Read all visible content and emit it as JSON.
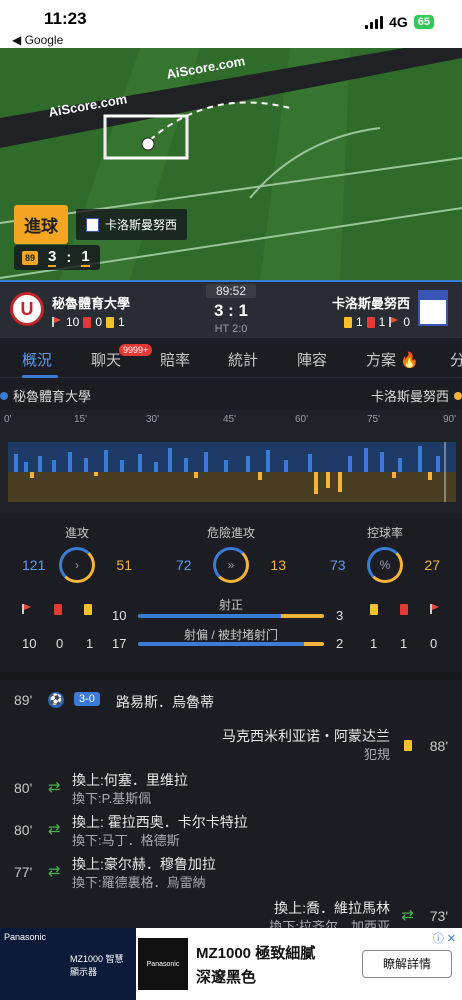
{
  "status": {
    "time": "11:23",
    "back_label": "◀ Google",
    "network": "4G",
    "battery": "65"
  },
  "pitch": {
    "brand": "AiScore.com",
    "goal_label": "進球",
    "goal_team": "卡洛斯曼努西",
    "mini_minute": "89",
    "mini_home": "3",
    "mini_sep": ":",
    "mini_away": "1"
  },
  "match": {
    "home_name": "秘魯體育大學",
    "away_name": "卡洛斯曼努西",
    "home_crest": "U",
    "time": "89:52",
    "score": "3 : 1",
    "ht": "HT 2:0",
    "home_corners": "10",
    "home_red": "0",
    "home_yellow": "1",
    "away_yellow": "1",
    "away_red": "1",
    "away_corners": "0"
  },
  "tabs": {
    "overview": "概況",
    "chat": "聊天",
    "chat_badge": "9999+",
    "odds": "賠率",
    "stats": "統計",
    "lineup": "陣容",
    "plan": "方案",
    "more": "分"
  },
  "teams_row": {
    "home": "秘魯體育大學",
    "away": "卡洛斯曼努西"
  },
  "timeline": {
    "ticks": [
      "0'",
      "15'",
      "30'",
      "45'",
      "60'",
      "75'",
      "90'"
    ]
  },
  "kpis": {
    "attack": {
      "title": "進攻",
      "home": "121",
      "away": "51",
      "icon": "chevron-right-icon"
    },
    "danger": {
      "title": "危險進攻",
      "home": "72",
      "away": "13",
      "icon": "double-chevron-icon"
    },
    "possession": {
      "title": "控球率",
      "home": "73",
      "away": "27",
      "icon": "percent-icon"
    }
  },
  "shots": {
    "on_target_label": "射正",
    "on_home": "10",
    "on_away": "3",
    "on_home_share": 0.77,
    "off_label": "射偏 / 被封堵射门",
    "off_home": "17",
    "off_away": "2",
    "off_home_share": 0.89,
    "home_corners": "10",
    "home_red": "0",
    "home_yellow": "1",
    "away_yellow": "1",
    "away_red": "1",
    "away_corners": "0"
  },
  "events": [
    {
      "minute": "89'",
      "score": "3-0",
      "player": "路易斯．烏魯蒂"
    },
    {
      "minute": "88'",
      "player": "马克西米利亚诺・阿蒙达兰",
      "note": "犯規"
    },
    {
      "minute": "80'",
      "in": "換上:何塞．里维拉",
      "out": "換下:P.基斯佩"
    },
    {
      "minute": "80'",
      "in": "換上: 霍拉西奥．卡尔卡特拉",
      "out": "換下:马丁．格德斯"
    },
    {
      "minute": "77'",
      "in": "換上:豪尔赫．穆鲁加拉",
      "out": "換下:羅德裏格．烏雷納"
    },
    {
      "minute": "73'",
      "in": "換上:喬．維拉馬林",
      "out": "換下:拉齐尔．加西亚"
    }
  ],
  "ad": {
    "brand": "Panasonic",
    "title": "MZ1000 極致細膩",
    "subtitle": "深邃黑色",
    "button": "瞭解詳情",
    "left_text": "MZ1000 智慧顯示器",
    "box_text": "Panasonic"
  }
}
